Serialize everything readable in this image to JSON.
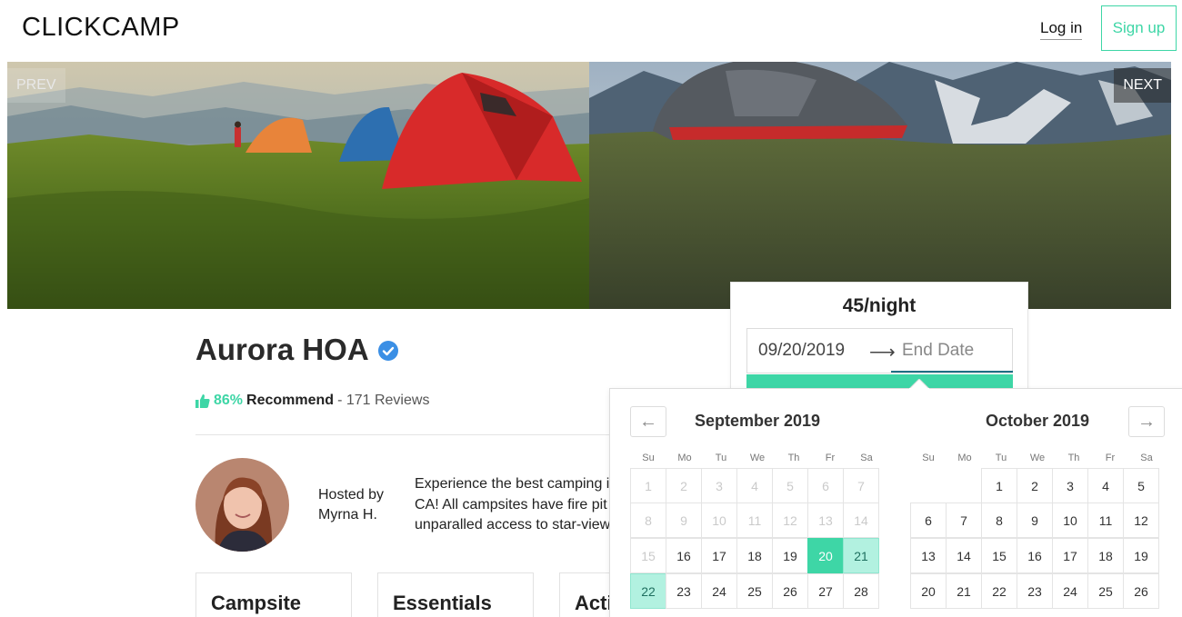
{
  "header": {
    "logo": "CLICKCAMP",
    "login_label": "Log in",
    "signup_label": "Sign up"
  },
  "hero": {
    "prev_label": "PREV",
    "next_label": "NEXT",
    "images": [
      "tents-on-mountain-meadow",
      "tent-on-grassy-hill"
    ]
  },
  "listing": {
    "title": "Aurora HOA",
    "recommend_pct": "86%",
    "recommend_label": "Recommend",
    "reviews": "- 171 Reviews",
    "hosted_by_label": "Hosted by",
    "host_name": "Myrna H.",
    "description_lines": [
      "Experience the best camping i",
      "CA! All campsites have fire pit",
      "unparalled access to star-view"
    ],
    "cards": [
      "Campsite",
      "Essentials",
      "Acti"
    ]
  },
  "booking": {
    "price": "45/night",
    "start_date": "09/20/2019",
    "end_date_placeholder": "End Date"
  },
  "calendar": {
    "weekdays": [
      "Su",
      "Mo",
      "Tu",
      "We",
      "Th",
      "Fr",
      "Sa"
    ],
    "months": [
      {
        "title": "September 2019",
        "rows": [
          [
            "1",
            "2",
            "3",
            "4",
            "5",
            "6",
            "7"
          ],
          [
            "8",
            "9",
            "10",
            "11",
            "12",
            "13",
            "14"
          ],
          [
            "15",
            "16",
            "17",
            "18",
            "19",
            "20",
            "21"
          ],
          [
            "22",
            "23",
            "24",
            "25",
            "26",
            "27",
            "28"
          ]
        ],
        "past_until": 15,
        "selected": "20",
        "hover_range": [
          "21",
          "22"
        ]
      },
      {
        "title": "October 2019",
        "rows": [
          [
            "",
            "",
            "1",
            "2",
            "3",
            "4",
            "5"
          ],
          [
            "6",
            "7",
            "8",
            "9",
            "10",
            "11",
            "12"
          ],
          [
            "13",
            "14",
            "15",
            "16",
            "17",
            "18",
            "19"
          ],
          [
            "20",
            "21",
            "22",
            "23",
            "24",
            "25",
            "26"
          ]
        ]
      }
    ]
  },
  "colors": {
    "accent": "#3ed6a6",
    "accent_light": "#b2f1e0",
    "verified_blue": "#3b8fe5"
  }
}
